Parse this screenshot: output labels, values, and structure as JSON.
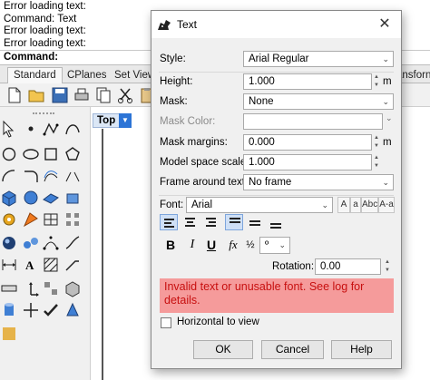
{
  "command_history": [
    "Error loading text:",
    "Command: Text",
    "Error loading text:",
    "Error loading text:"
  ],
  "command_prompt": "Command:",
  "tabs": [
    "Standard",
    "CPlanes",
    "Set View",
    "ansforn"
  ],
  "viewport": {
    "label": "Top"
  },
  "dialog": {
    "title": "Text",
    "fields": {
      "style_label": "Style:",
      "style_value": "Arial Regular",
      "height_label": "Height:",
      "height_value": "1.000",
      "height_unit": "m",
      "mask_label": "Mask:",
      "mask_value": "None",
      "mask_color_label": "Mask Color:",
      "mask_color_value": "",
      "mask_margins_label": "Mask margins:",
      "mask_margins_value": "0.000",
      "mask_margins_unit": "m",
      "model_space_scale_label": "Model space scale:",
      "model_space_scale_value": "1.000",
      "frame_label": "Frame around text:",
      "frame_value": "No frame",
      "font_label": "Font:",
      "font_value": "Arial",
      "rotation_label": "Rotation:",
      "rotation_value": "0.00",
      "number_format_value": "º"
    },
    "case_buttons": [
      "A",
      "a",
      "Abc",
      "A-a"
    ],
    "style_buttons": {
      "bold": "B",
      "italic": "I",
      "underline": "U",
      "function": "fx",
      "fraction": "½"
    },
    "error_message": "Invalid text or unusable font. See log for details.",
    "checkbox_label": "Horizontal to view",
    "buttons": {
      "ok": "OK",
      "cancel": "Cancel",
      "help": "Help"
    }
  }
}
